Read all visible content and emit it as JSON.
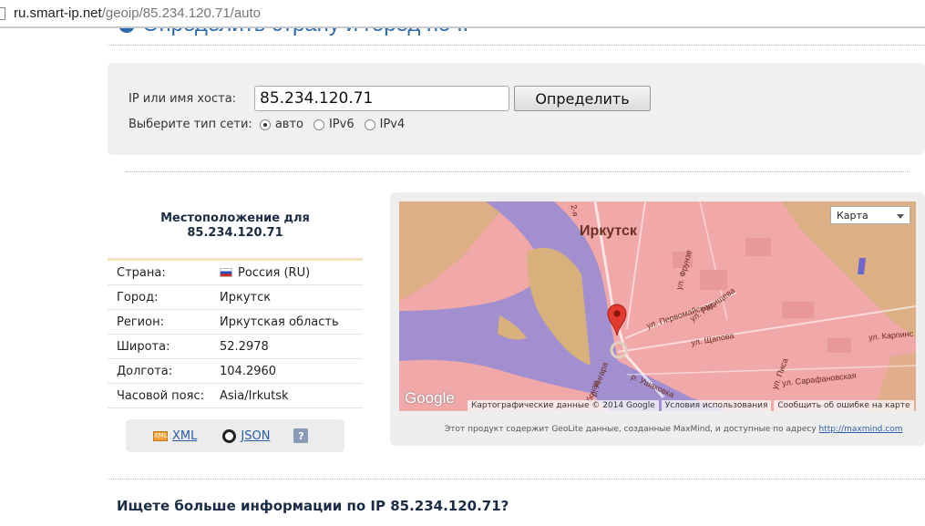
{
  "browser": {
    "url_host": "ru.smart-ip.net",
    "url_path": "/geoip/85.234.120.71/auto"
  },
  "page": {
    "title": "Определить страну и город по IP"
  },
  "form": {
    "ip_label": "IP или имя хоста:",
    "ip_value": "85.234.120.71",
    "submit_label": "Определить",
    "network_label": "Выберите тип сети:",
    "network_options": [
      {
        "label": "авто",
        "selected": true
      },
      {
        "label": "IPv6",
        "selected": false
      },
      {
        "label": "IPv4",
        "selected": false
      }
    ]
  },
  "location": {
    "heading_line1": "Местоположение для",
    "heading_line2": "85.234.120.71",
    "rows": [
      {
        "key": "Страна:",
        "value": "Россия (RU)"
      },
      {
        "key": "Город:",
        "value": "Иркутск"
      },
      {
        "key": "Регион:",
        "value": "Иркутская область"
      },
      {
        "key": "Широта:",
        "value": "52.2978"
      },
      {
        "key": "Долгота:",
        "value": "104.2960"
      },
      {
        "key": "Часовой пояс:",
        "value": "Asia/Irkutsk"
      }
    ],
    "export": {
      "xml_label": "XML",
      "json_label": "JSON",
      "help_label": "?"
    }
  },
  "map": {
    "type_select": "Карта",
    "city_label": "Иркутск",
    "logo": "Google",
    "footer": [
      "Картографические данные © 2014 Google",
      "Условия использования",
      "Сообщить об ошибке на карте"
    ],
    "streets": {
      "angara": "р. Ангара",
      "pervomaiskaya": "ул. Первомайская",
      "radishcheva": "ул. Радищева",
      "shchapova": "ул. Щапова",
      "sarafanovskaya": "ул. Сарафановская",
      "karpinskogo": "ул. Карпинс",
      "frunze": "ул. Фрунзе",
      "ushakovka": "р. Ушаковка",
      "pisa": "ул. Писа",
      "roadv": "бочая",
      "roadw": "2-я"
    },
    "note_text": "Этот продукт содержит GeoLite данные, созданные MaxMind, и доступные по адресу ",
    "note_link": "http://maxmind.com",
    "colors": {
      "land": "#f0a8a8",
      "water": "#a28fd0",
      "green": "#d8b07c"
    }
  },
  "more": {
    "heading": "Ищете больше информации по IP 85.234.120.71?"
  }
}
